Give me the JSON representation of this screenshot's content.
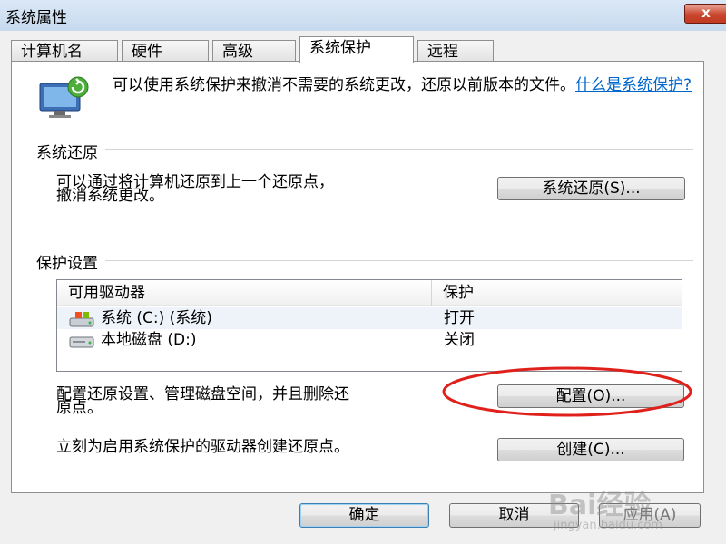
{
  "window": {
    "title": "系统属性",
    "close_glyph": "x"
  },
  "tabs": [
    {
      "label": "计算机名",
      "active": false
    },
    {
      "label": "硬件",
      "active": false
    },
    {
      "label": "高级",
      "active": false
    },
    {
      "label": "系统保护",
      "active": true
    },
    {
      "label": "远程",
      "active": false
    }
  ],
  "intro": {
    "text": "可以使用系统保护来撤消不需要的系统更改，还原以前版本的文件。",
    "link": "什么是系统保护?"
  },
  "restore": {
    "title": "系统还原",
    "desc_line1": "可以通过将计算机还原到上一个还原点，",
    "desc_line2": "撤消系统更改。",
    "button": "系统还原(S)..."
  },
  "protection": {
    "title": "保护设置",
    "columns": [
      "可用驱动器",
      "保护"
    ],
    "drives": [
      {
        "name": "系统 (C:) (系统)",
        "status": "打开",
        "icon": "system-drive-icon",
        "selected": true
      },
      {
        "name": "本地磁盘 (D:)",
        "status": "关闭",
        "icon": "hard-disk-icon",
        "selected": false
      }
    ],
    "config_line1": "配置还原设置、管理磁盘空间，并且删除还",
    "config_line2": "原点。",
    "config_button": "配置(O)...",
    "create_text": "立刻为启用系统保护的驱动器创建还原点。",
    "create_button": "创建(C)..."
  },
  "footer": {
    "ok": "确定",
    "cancel": "取消",
    "apply": "应用(A)"
  },
  "watermark": {
    "brand": "Bai经验",
    "url": "jingyan.baidu.com"
  },
  "colors": {
    "link": "#0066cc",
    "annotation": "#e0201b",
    "titlebar": "#c7daee"
  }
}
